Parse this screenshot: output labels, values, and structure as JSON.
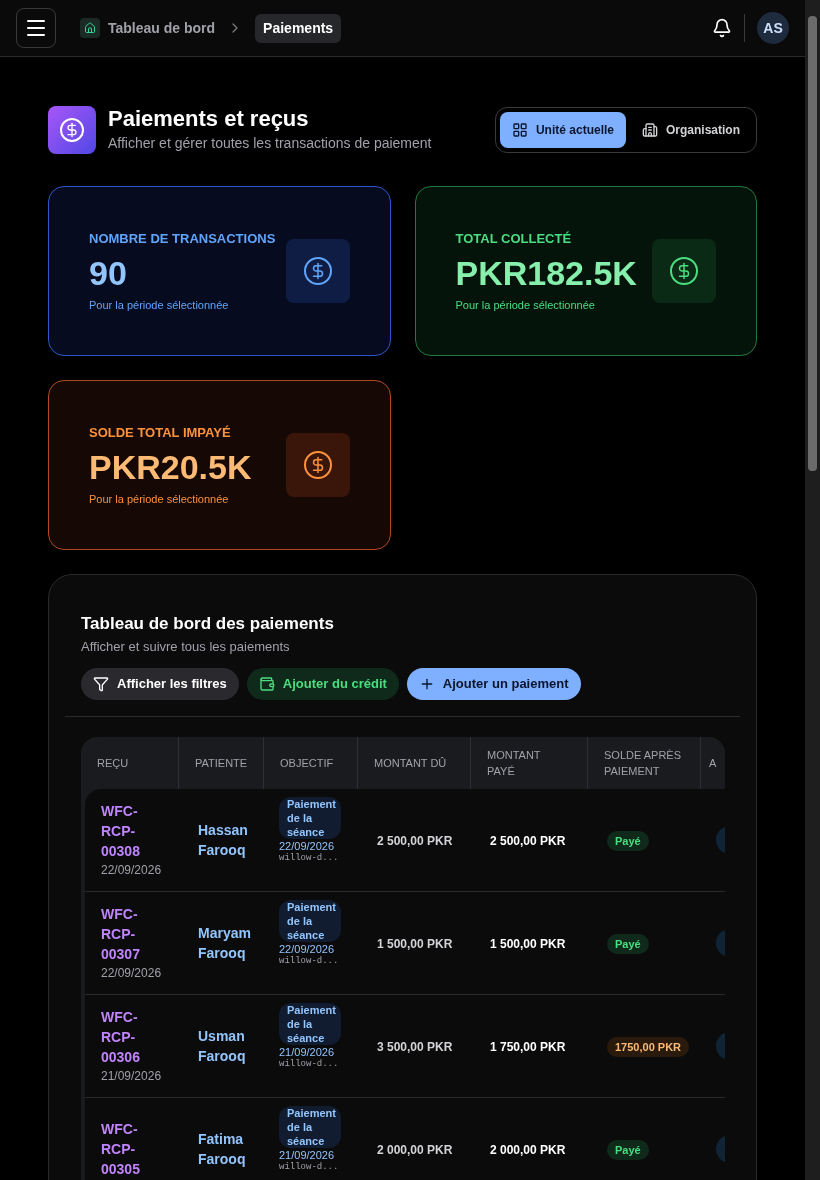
{
  "topbar": {
    "breadcrumbs": [
      {
        "label": "Tableau de bord",
        "selected": false
      },
      {
        "label": "Paiements",
        "selected": true
      }
    ],
    "avatar": "AS"
  },
  "header": {
    "title": "Paiements et reçus",
    "subtitle": "Afficher et gérer toutes les transactions de paiement",
    "scope_tabs": [
      {
        "label": "Unité actuelle",
        "selected": true
      },
      {
        "label": "Organisation",
        "selected": false
      }
    ]
  },
  "stats": [
    {
      "label": "NOMBRE DE TRANSACTIONS",
      "value": "90",
      "note": "Pour la période sélectionnée",
      "color": "#60a5fa"
    },
    {
      "label": "TOTAL COLLECTÉ",
      "value": "PKR182.5K",
      "note": "Pour la période sélectionnée",
      "color": "#4ade80"
    },
    {
      "label": "SOLDE TOTAL IMPAYÉ",
      "value": "PKR20.5K",
      "note": "Pour la période sélectionnée",
      "color": "#fb923c"
    }
  ],
  "panel": {
    "title": "Tableau de bord des paiements",
    "subtitle": "Afficher et suivre tous les paiements",
    "actions": [
      {
        "kind": "filter",
        "label": "Afficher les filtres"
      },
      {
        "kind": "credit",
        "label": "Ajouter du crédit"
      },
      {
        "kind": "add",
        "label": "Ajouter un paiement"
      }
    ]
  },
  "table": {
    "columns": [
      "REÇU",
      "PATIENTE",
      "OBJECTIF",
      "MONTANT DÛ",
      "MONTANT PAYÉ",
      "SOLDE APRÈS PAIEMENT",
      "A"
    ],
    "rows": [
      {
        "receipt": "WFC-RCP-00308",
        "date": "22/09/2026",
        "patient": "Hassan Farooq",
        "purpose": "Paiement de la séance",
        "purpose_date": "22/09/2026",
        "ref": "willow-d...",
        "due": "2 500,00 PKR",
        "paid": "2 500,00 PKR",
        "balance": {
          "kind": "paid",
          "label": "Payé"
        }
      },
      {
        "receipt": "WFC-RCP-00307",
        "date": "22/09/2026",
        "patient": "Maryam Farooq",
        "purpose": "Paiement de la séance",
        "purpose_date": "22/09/2026",
        "ref": "willow-d...",
        "due": "1 500,00 PKR",
        "paid": "1 500,00 PKR",
        "balance": {
          "kind": "paid",
          "label": "Payé"
        }
      },
      {
        "receipt": "WFC-RCP-00306",
        "date": "21/09/2026",
        "patient": "Usman Farooq",
        "purpose": "Paiement de la séance",
        "purpose_date": "21/09/2026",
        "ref": "willow-d...",
        "due": "3 500,00 PKR",
        "paid": "1 750,00 PKR",
        "balance": {
          "kind": "due",
          "label": "1750,00 PKR"
        }
      },
      {
        "receipt": "WFC-RCP-00305",
        "patient": "Fatima Farooq",
        "purpose": "Paiement de la séance",
        "purpose_date": "21/09/2026",
        "ref": "willow-d...",
        "due": "2 000,00 PKR",
        "paid": "2 000,00 PKR",
        "balance": {
          "kind": "paid",
          "label": "Payé"
        }
      }
    ]
  }
}
